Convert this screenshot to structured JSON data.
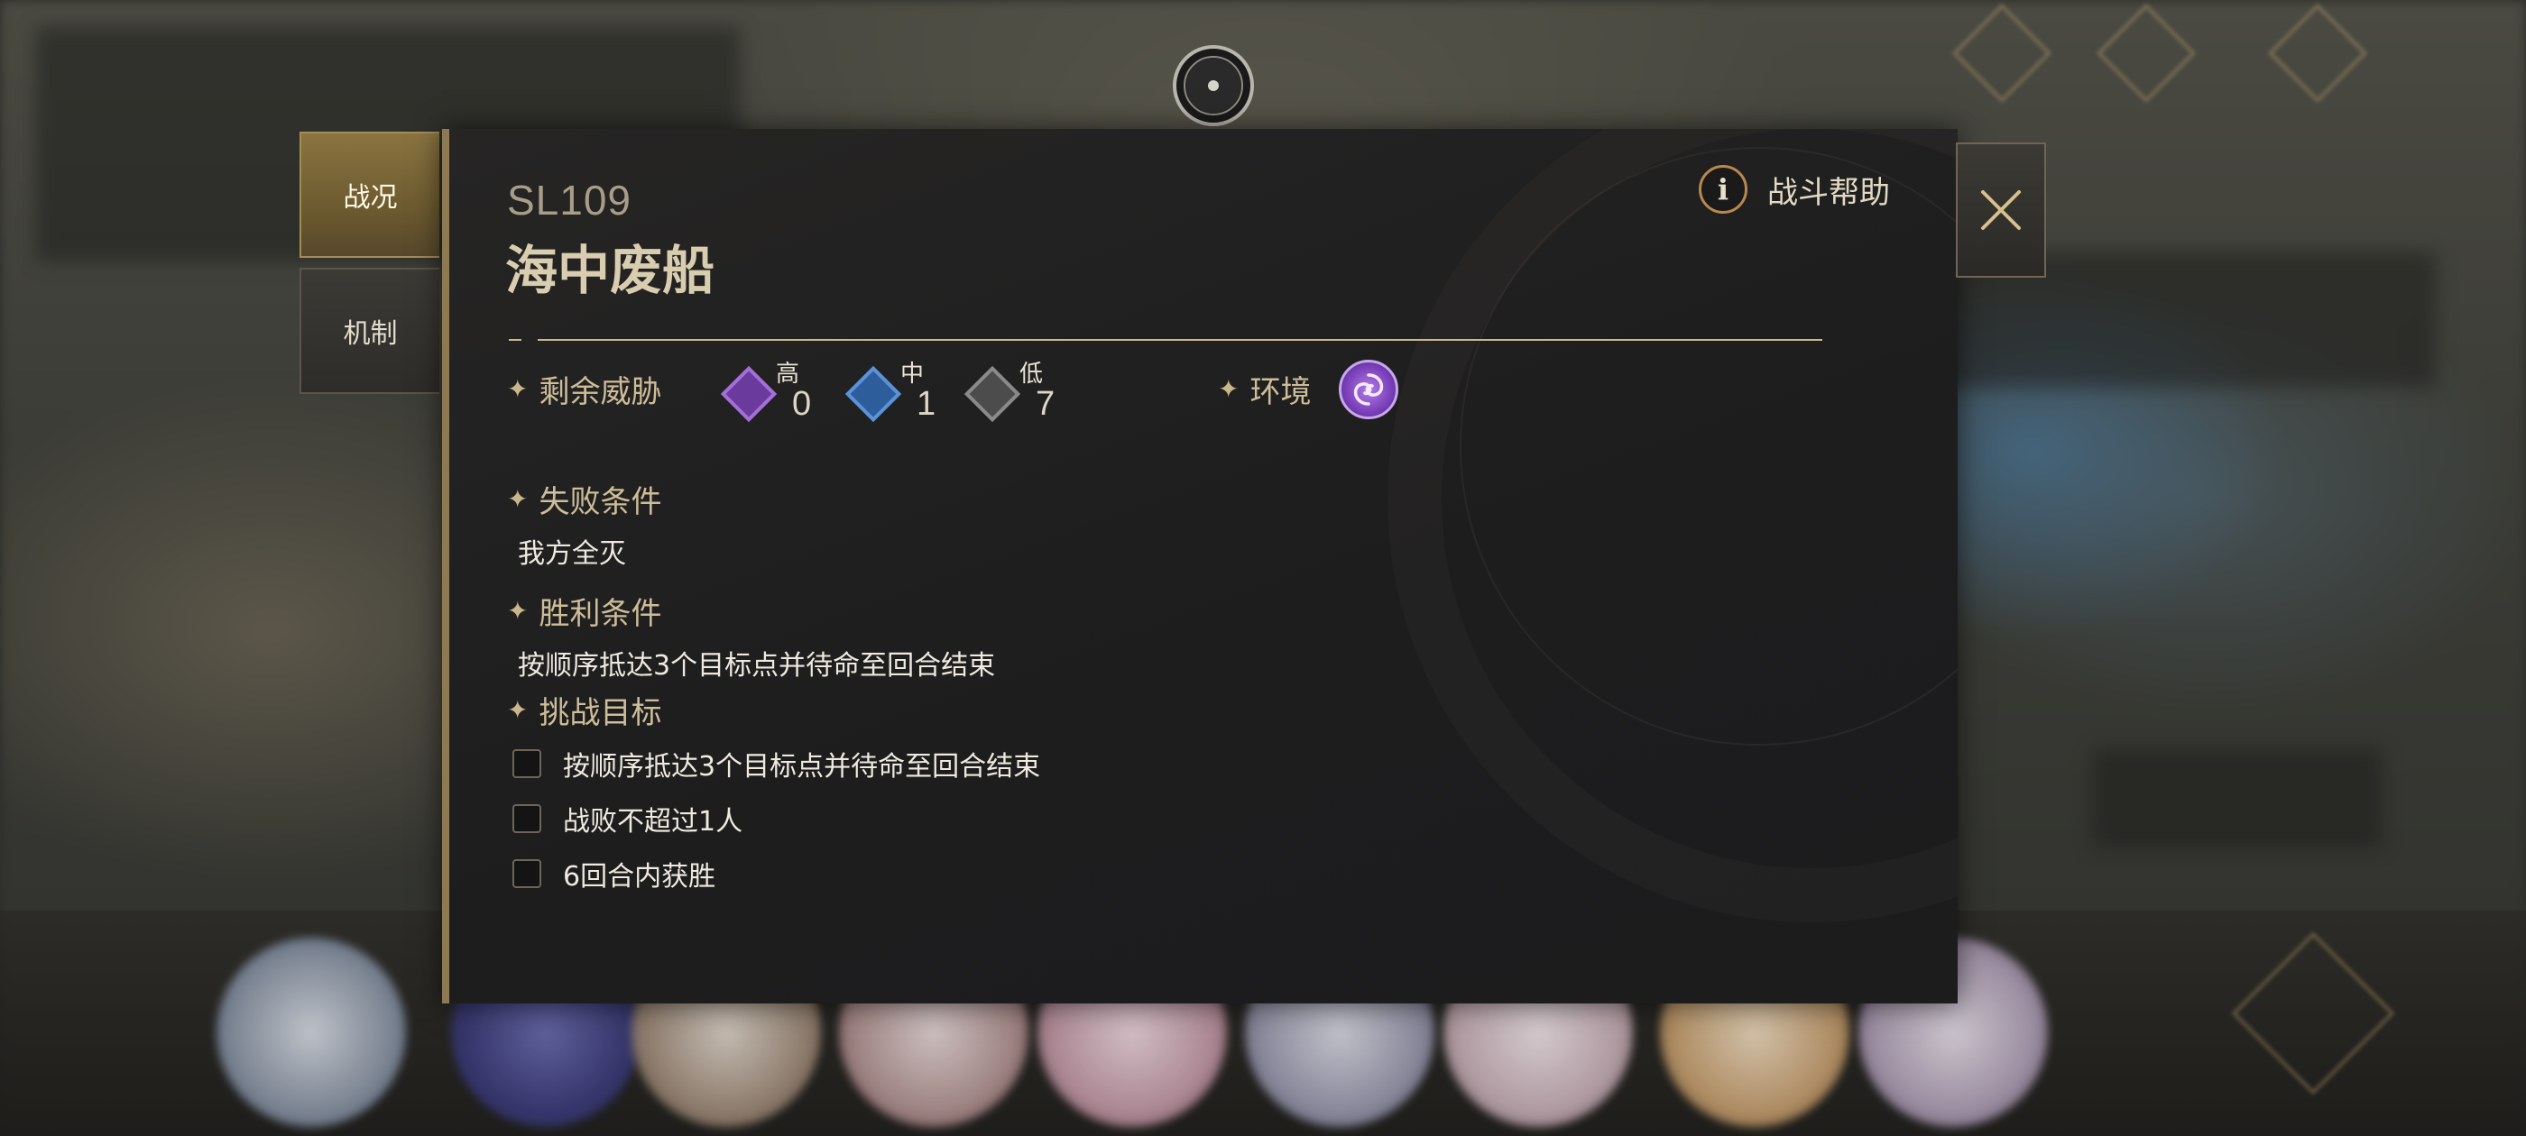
{
  "tabs": [
    {
      "label": "战况",
      "active": true
    },
    {
      "label": "机制",
      "active": false
    }
  ],
  "stage": {
    "code": "SL109",
    "name": "海中废船"
  },
  "help": {
    "icon": "info-icon",
    "icon_glyph": "i",
    "label": "战斗帮助"
  },
  "threats": {
    "label": "剩余威胁",
    "items": [
      {
        "level": "高",
        "count": "0",
        "color": "#6a3a9c"
      },
      {
        "level": "中",
        "count": "1",
        "color": "#2e5d9c"
      },
      {
        "level": "低",
        "count": "7",
        "color": "#4c4c4c"
      }
    ]
  },
  "environment": {
    "label": "环境",
    "icon": "vortex-icon"
  },
  "defeat": {
    "label": "失败条件",
    "text": "我方全灭"
  },
  "victory": {
    "label": "胜利条件",
    "text": "按顺序抵达3个目标点并待命至回合结束"
  },
  "challenge": {
    "label": "挑战目标",
    "items": [
      {
        "text": "按顺序抵达3个目标点并待命至回合结束",
        "checked": false
      },
      {
        "text": "战败不超过1人",
        "checked": false
      },
      {
        "text": "6回合内获胜",
        "checked": false
      }
    ]
  },
  "close": {
    "icon": "close-icon"
  },
  "colors": {
    "accent_gold": "#cbb88e",
    "panel_bg": "#1e1e1f",
    "tab_active": "#7a6638"
  }
}
